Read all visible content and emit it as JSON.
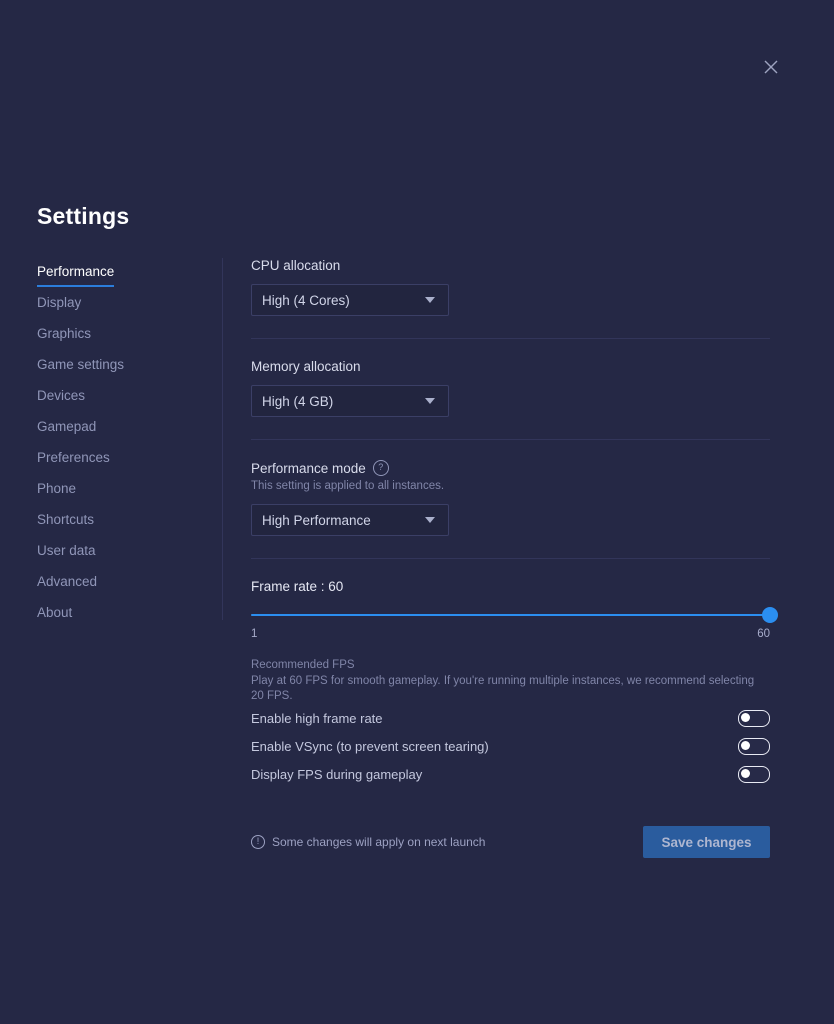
{
  "window": {
    "close_icon": "close-icon",
    "title": "Settings"
  },
  "sidebar": {
    "items": [
      {
        "label": "Performance",
        "active": true
      },
      {
        "label": "Display",
        "active": false
      },
      {
        "label": "Graphics",
        "active": false
      },
      {
        "label": "Game settings",
        "active": false
      },
      {
        "label": "Devices",
        "active": false
      },
      {
        "label": "Gamepad",
        "active": false
      },
      {
        "label": "Preferences",
        "active": false
      },
      {
        "label": "Phone",
        "active": false
      },
      {
        "label": "Shortcuts",
        "active": false
      },
      {
        "label": "User data",
        "active": false
      },
      {
        "label": "Advanced",
        "active": false
      },
      {
        "label": "About",
        "active": false
      }
    ]
  },
  "main": {
    "cpu": {
      "label": "CPU allocation",
      "value": "High (4 Cores)"
    },
    "memory": {
      "label": "Memory allocation",
      "value": "High (4 GB)"
    },
    "performance_mode": {
      "label": "Performance mode",
      "help_icon": "question-mark-icon",
      "note": "This setting is applied to all instances.",
      "value": "High Performance"
    },
    "frame_rate": {
      "title": "Frame rate : 60",
      "value": 60,
      "min_label": "1",
      "max_label": "60",
      "min": 1,
      "max": 60,
      "recommend_title": "Recommended FPS",
      "recommend_text": "Play at 60 FPS for smooth gameplay. If you're running multiple instances, we recommend selecting 20 FPS."
    },
    "toggles": [
      {
        "label": "Enable high frame rate",
        "on": false
      },
      {
        "label": "Enable VSync (to prevent screen tearing)",
        "on": false
      },
      {
        "label": "Display FPS during gameplay",
        "on": false
      }
    ],
    "footer": {
      "info_icon": "info-icon",
      "note": "Some changes will apply on next launch",
      "save_label": "Save changes"
    }
  },
  "colors": {
    "background": "#252845",
    "accent_blue": "#2b8ef0",
    "save_button": "#2a5c9e",
    "divider": "#32355a",
    "field_bg": "#22253f"
  }
}
